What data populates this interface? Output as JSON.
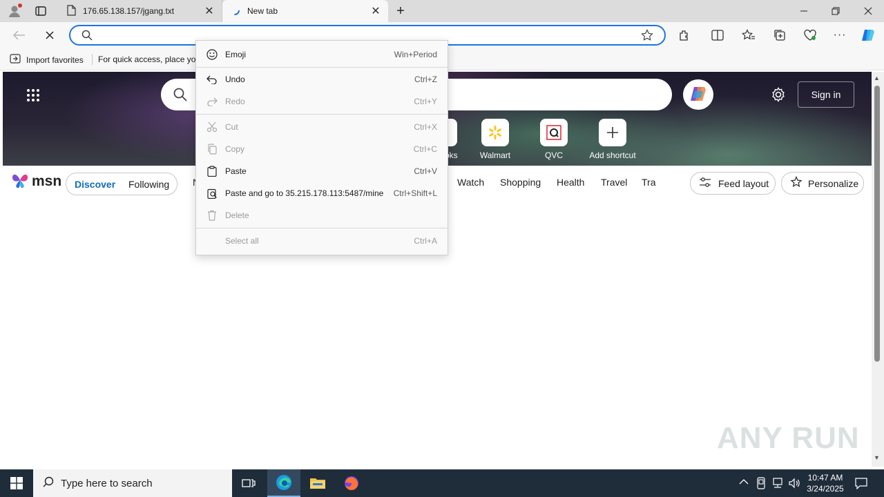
{
  "browser": {
    "tabs": [
      {
        "title": "176.65.138.157/jgang.txt",
        "active": false
      },
      {
        "title": "New tab",
        "active": true
      }
    ],
    "favorites_bar": {
      "import_label": "Import favorites",
      "hint": "For quick access, place you"
    }
  },
  "msn": {
    "logo_text": "msn",
    "shortcuts": [
      {
        "label": "oks",
        "icon": "partial-shortcut"
      },
      {
        "label": "Walmart",
        "icon": "walmart-icon"
      },
      {
        "label": "QVC",
        "icon": "qvc-icon"
      },
      {
        "label": "Add shortcut",
        "icon": "plus-icon"
      }
    ],
    "sign_in": "Sign in",
    "feed_tabs": [
      "Discover",
      "Following"
    ],
    "nav_partial": "N",
    "nav_links": [
      "Watch",
      "Shopping",
      "Health",
      "Travel",
      "Tra"
    ],
    "feed_layout": "Feed layout",
    "personalize": "Personalize"
  },
  "context_menu": {
    "items": [
      {
        "label": "Emoji",
        "shortcut": "Win+Period",
        "enabled": true,
        "icon": "emoji-icon"
      },
      {
        "label": "Undo",
        "shortcut": "Ctrl+Z",
        "enabled": true,
        "icon": "undo-icon"
      },
      {
        "label": "Redo",
        "shortcut": "Ctrl+Y",
        "enabled": false,
        "icon": "redo-icon"
      },
      {
        "label": "Cut",
        "shortcut": "Ctrl+X",
        "enabled": false,
        "icon": "cut-icon"
      },
      {
        "label": "Copy",
        "shortcut": "Ctrl+C",
        "enabled": false,
        "icon": "copy-icon"
      },
      {
        "label": "Paste",
        "shortcut": "Ctrl+V",
        "enabled": true,
        "icon": "paste-icon"
      },
      {
        "label": "Paste and go to 35.215.178.113:5487/mine",
        "shortcut": "Ctrl+Shift+L",
        "enabled": true,
        "icon": "paste-go-icon"
      },
      {
        "label": "Delete",
        "shortcut": "",
        "enabled": false,
        "icon": "delete-icon"
      },
      {
        "label": "Select all",
        "shortcut": "Ctrl+A",
        "enabled": false,
        "icon": ""
      }
    ]
  },
  "taskbar": {
    "search_placeholder": "Type here to search",
    "time": "10:47 AM",
    "date": "3/24/2025"
  },
  "watermark": "ANY RUN",
  "colors": {
    "accent": "#1a73e8",
    "msn_blue": "#0f6cbd",
    "taskbar": "#1f2c3a"
  }
}
